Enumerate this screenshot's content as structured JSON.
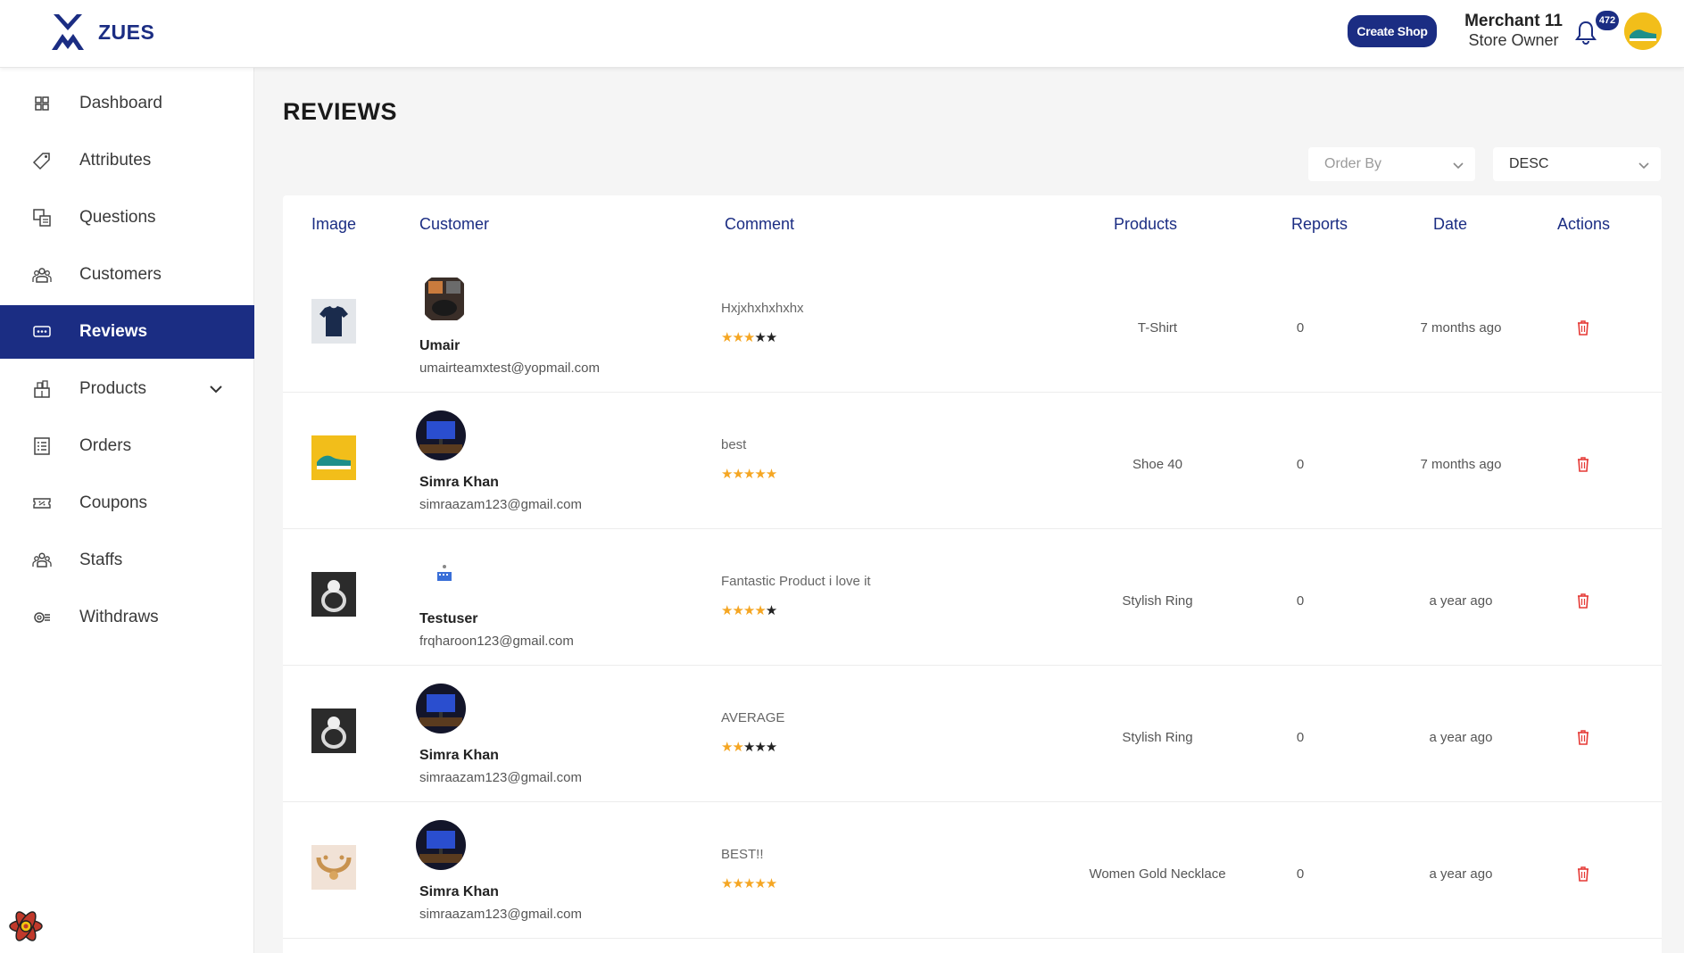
{
  "brand": {
    "name": "ZUES",
    "color": "#1b2d83"
  },
  "header": {
    "create_shop_label": "Create Shop",
    "user_name": "Merchant 11",
    "user_role": "Store Owner",
    "notification_count": "472",
    "bell_icon": "bell-icon"
  },
  "sidebar": {
    "items": [
      {
        "label": "Dashboard",
        "icon": "dashboard-icon"
      },
      {
        "label": "Attributes",
        "icon": "tag-icon"
      },
      {
        "label": "Questions",
        "icon": "questions-icon"
      },
      {
        "label": "Customers",
        "icon": "customers-icon"
      },
      {
        "label": "Reviews",
        "icon": "reviews-icon",
        "active": true
      },
      {
        "label": "Products",
        "icon": "products-icon",
        "expandable": true
      },
      {
        "label": "Orders",
        "icon": "orders-icon"
      },
      {
        "label": "Coupons",
        "icon": "coupons-icon"
      },
      {
        "label": "Staffs",
        "icon": "staffs-icon"
      },
      {
        "label": "Withdraws",
        "icon": "withdraws-icon"
      }
    ]
  },
  "page": {
    "title": "REVIEWS",
    "order_by_placeholder": "Order By",
    "direction_value": "DESC"
  },
  "table": {
    "headers": {
      "image": "Image",
      "customer": "Customer",
      "comment": "Comment",
      "products": "Products",
      "reports": "Reports",
      "date": "Date",
      "actions": "Actions"
    },
    "rows": [
      {
        "product_image": "tshirt-image",
        "avatar": "avatar-umair",
        "customer_name": "Umair",
        "customer_email": "umairteamxtest@yopmail.com",
        "comment": "Hxjxhxhxhxhx",
        "rating": 3,
        "product": "T-Shirt",
        "reports": "0",
        "date": "7 months ago"
      },
      {
        "product_image": "shoe-image",
        "avatar": "avatar-simra",
        "customer_name": "Simra Khan",
        "customer_email": "simraazam123@gmail.com",
        "comment": "best",
        "rating": 5,
        "product": "Shoe 40",
        "reports": "0",
        "date": "7 months ago"
      },
      {
        "product_image": "ring-image",
        "avatar": "avatar-testuser",
        "customer_name": "Testuser",
        "customer_email": "frqharoon123@gmail.com",
        "comment": "Fantastic Product i love it",
        "rating": 4,
        "product": "Stylish Ring",
        "reports": "0",
        "date": "a year ago"
      },
      {
        "product_image": "ring-image",
        "avatar": "avatar-simra",
        "customer_name": "Simra Khan",
        "customer_email": "simraazam123@gmail.com",
        "comment": "AVERAGE",
        "rating": 2,
        "product": "Stylish Ring",
        "reports": "0",
        "date": "a year ago"
      },
      {
        "product_image": "necklace-image",
        "avatar": "avatar-simra",
        "customer_name": "Simra Khan",
        "customer_email": "simraazam123@gmail.com",
        "comment": "BEST!!",
        "rating": 5,
        "product": "Women Gold Necklace",
        "reports": "0",
        "date": "a year ago"
      }
    ]
  },
  "colors": {
    "primary": "#1b2d83",
    "star": "#f5a623",
    "delete": "#e53935",
    "background": "#f5f5f5"
  }
}
